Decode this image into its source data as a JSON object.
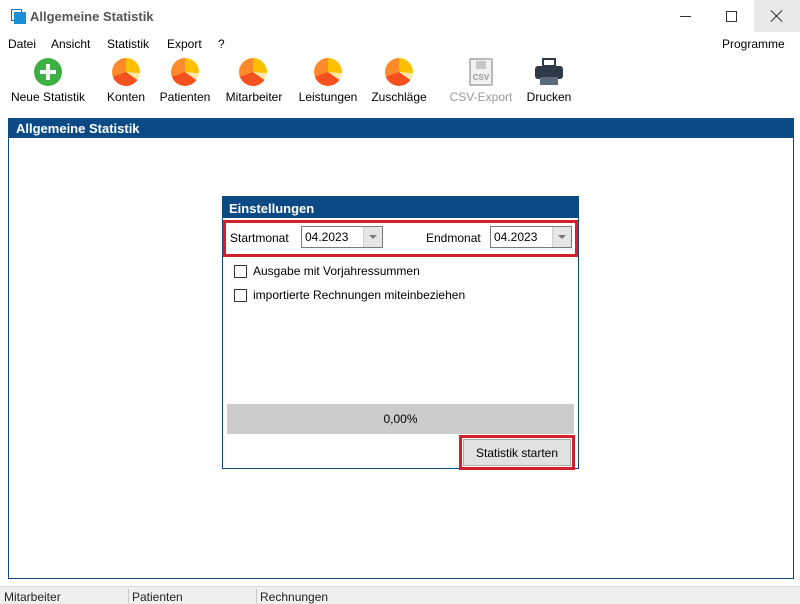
{
  "window": {
    "title": "Allgemeine Statistik"
  },
  "menu": {
    "items": [
      "Datei",
      "Ansicht",
      "Statistik",
      "Export",
      "?"
    ],
    "right": "Programme"
  },
  "toolbar": {
    "buttons": [
      {
        "label": "Neue Statistik",
        "icon": "add-circle-icon"
      },
      {
        "label": "Konten",
        "icon": "pie-chart-icon"
      },
      {
        "label": "Patienten",
        "icon": "pie-chart-icon"
      },
      {
        "label": "Mitarbeiter",
        "icon": "pie-chart-icon"
      },
      {
        "label": "Leistungen",
        "icon": "pie-chart-icon"
      },
      {
        "label": "Zuschläge",
        "icon": "pie-chart-icon"
      },
      {
        "label": "CSV-Export",
        "icon": "csv-file-icon",
        "disabled": true
      },
      {
        "label": "Drucken",
        "icon": "printer-icon"
      }
    ]
  },
  "section": {
    "title": "Allgemeine Statistik"
  },
  "settings": {
    "title": "Einstellungen",
    "start_label": "Startmonat",
    "start_value": "04.2023",
    "end_label": "Endmonat",
    "end_value": "04.2023",
    "checkbox1": "Ausgabe mit Vorjahressummen",
    "checkbox2": "importierte Rechnungen miteinbeziehen",
    "progress_text": "0,00%",
    "progress_value": 0,
    "start_button": "Statistik starten"
  },
  "statusbar": {
    "items": [
      "Mitarbeiter",
      "Patienten",
      "Rechnungen"
    ]
  },
  "colors": {
    "header_blue": "#0b4a84",
    "highlight_red": "#d4202a",
    "add_green": "#3cb043"
  }
}
